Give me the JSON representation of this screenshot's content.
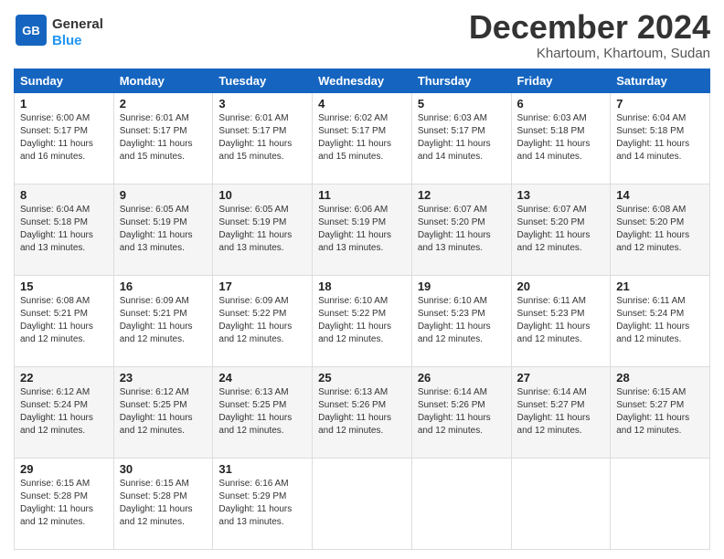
{
  "header": {
    "logo_general": "General",
    "logo_blue": "Blue",
    "month_title": "December 2024",
    "location": "Khartoum, Khartoum, Sudan"
  },
  "days_of_week": [
    "Sunday",
    "Monday",
    "Tuesday",
    "Wednesday",
    "Thursday",
    "Friday",
    "Saturday"
  ],
  "weeks": [
    [
      {
        "day": "1",
        "sunrise": "6:00 AM",
        "sunset": "5:17 PM",
        "daylight": "11 hours and 16 minutes."
      },
      {
        "day": "2",
        "sunrise": "6:01 AM",
        "sunset": "5:17 PM",
        "daylight": "11 hours and 15 minutes."
      },
      {
        "day": "3",
        "sunrise": "6:01 AM",
        "sunset": "5:17 PM",
        "daylight": "11 hours and 15 minutes."
      },
      {
        "day": "4",
        "sunrise": "6:02 AM",
        "sunset": "5:17 PM",
        "daylight": "11 hours and 15 minutes."
      },
      {
        "day": "5",
        "sunrise": "6:03 AM",
        "sunset": "5:17 PM",
        "daylight": "11 hours and 14 minutes."
      },
      {
        "day": "6",
        "sunrise": "6:03 AM",
        "sunset": "5:18 PM",
        "daylight": "11 hours and 14 minutes."
      },
      {
        "day": "7",
        "sunrise": "6:04 AM",
        "sunset": "5:18 PM",
        "daylight": "11 hours and 14 minutes."
      }
    ],
    [
      {
        "day": "8",
        "sunrise": "6:04 AM",
        "sunset": "5:18 PM",
        "daylight": "11 hours and 13 minutes."
      },
      {
        "day": "9",
        "sunrise": "6:05 AM",
        "sunset": "5:19 PM",
        "daylight": "11 hours and 13 minutes."
      },
      {
        "day": "10",
        "sunrise": "6:05 AM",
        "sunset": "5:19 PM",
        "daylight": "11 hours and 13 minutes."
      },
      {
        "day": "11",
        "sunrise": "6:06 AM",
        "sunset": "5:19 PM",
        "daylight": "11 hours and 13 minutes."
      },
      {
        "day": "12",
        "sunrise": "6:07 AM",
        "sunset": "5:20 PM",
        "daylight": "11 hours and 13 minutes."
      },
      {
        "day": "13",
        "sunrise": "6:07 AM",
        "sunset": "5:20 PM",
        "daylight": "11 hours and 12 minutes."
      },
      {
        "day": "14",
        "sunrise": "6:08 AM",
        "sunset": "5:20 PM",
        "daylight": "11 hours and 12 minutes."
      }
    ],
    [
      {
        "day": "15",
        "sunrise": "6:08 AM",
        "sunset": "5:21 PM",
        "daylight": "11 hours and 12 minutes."
      },
      {
        "day": "16",
        "sunrise": "6:09 AM",
        "sunset": "5:21 PM",
        "daylight": "11 hours and 12 minutes."
      },
      {
        "day": "17",
        "sunrise": "6:09 AM",
        "sunset": "5:22 PM",
        "daylight": "11 hours and 12 minutes."
      },
      {
        "day": "18",
        "sunrise": "6:10 AM",
        "sunset": "5:22 PM",
        "daylight": "11 hours and 12 minutes."
      },
      {
        "day": "19",
        "sunrise": "6:10 AM",
        "sunset": "5:23 PM",
        "daylight": "11 hours and 12 minutes."
      },
      {
        "day": "20",
        "sunrise": "6:11 AM",
        "sunset": "5:23 PM",
        "daylight": "11 hours and 12 minutes."
      },
      {
        "day": "21",
        "sunrise": "6:11 AM",
        "sunset": "5:24 PM",
        "daylight": "11 hours and 12 minutes."
      }
    ],
    [
      {
        "day": "22",
        "sunrise": "6:12 AM",
        "sunset": "5:24 PM",
        "daylight": "11 hours and 12 minutes."
      },
      {
        "day": "23",
        "sunrise": "6:12 AM",
        "sunset": "5:25 PM",
        "daylight": "11 hours and 12 minutes."
      },
      {
        "day": "24",
        "sunrise": "6:13 AM",
        "sunset": "5:25 PM",
        "daylight": "11 hours and 12 minutes."
      },
      {
        "day": "25",
        "sunrise": "6:13 AM",
        "sunset": "5:26 PM",
        "daylight": "11 hours and 12 minutes."
      },
      {
        "day": "26",
        "sunrise": "6:14 AM",
        "sunset": "5:26 PM",
        "daylight": "11 hours and 12 minutes."
      },
      {
        "day": "27",
        "sunrise": "6:14 AM",
        "sunset": "5:27 PM",
        "daylight": "11 hours and 12 minutes."
      },
      {
        "day": "28",
        "sunrise": "6:15 AM",
        "sunset": "5:27 PM",
        "daylight": "11 hours and 12 minutes."
      }
    ],
    [
      {
        "day": "29",
        "sunrise": "6:15 AM",
        "sunset": "5:28 PM",
        "daylight": "11 hours and 12 minutes."
      },
      {
        "day": "30",
        "sunrise": "6:15 AM",
        "sunset": "5:28 PM",
        "daylight": "11 hours and 12 minutes."
      },
      {
        "day": "31",
        "sunrise": "6:16 AM",
        "sunset": "5:29 PM",
        "daylight": "11 hours and 13 minutes."
      },
      null,
      null,
      null,
      null
    ]
  ],
  "labels": {
    "sunrise": "Sunrise:",
    "sunset": "Sunset:",
    "daylight": "Daylight:"
  }
}
